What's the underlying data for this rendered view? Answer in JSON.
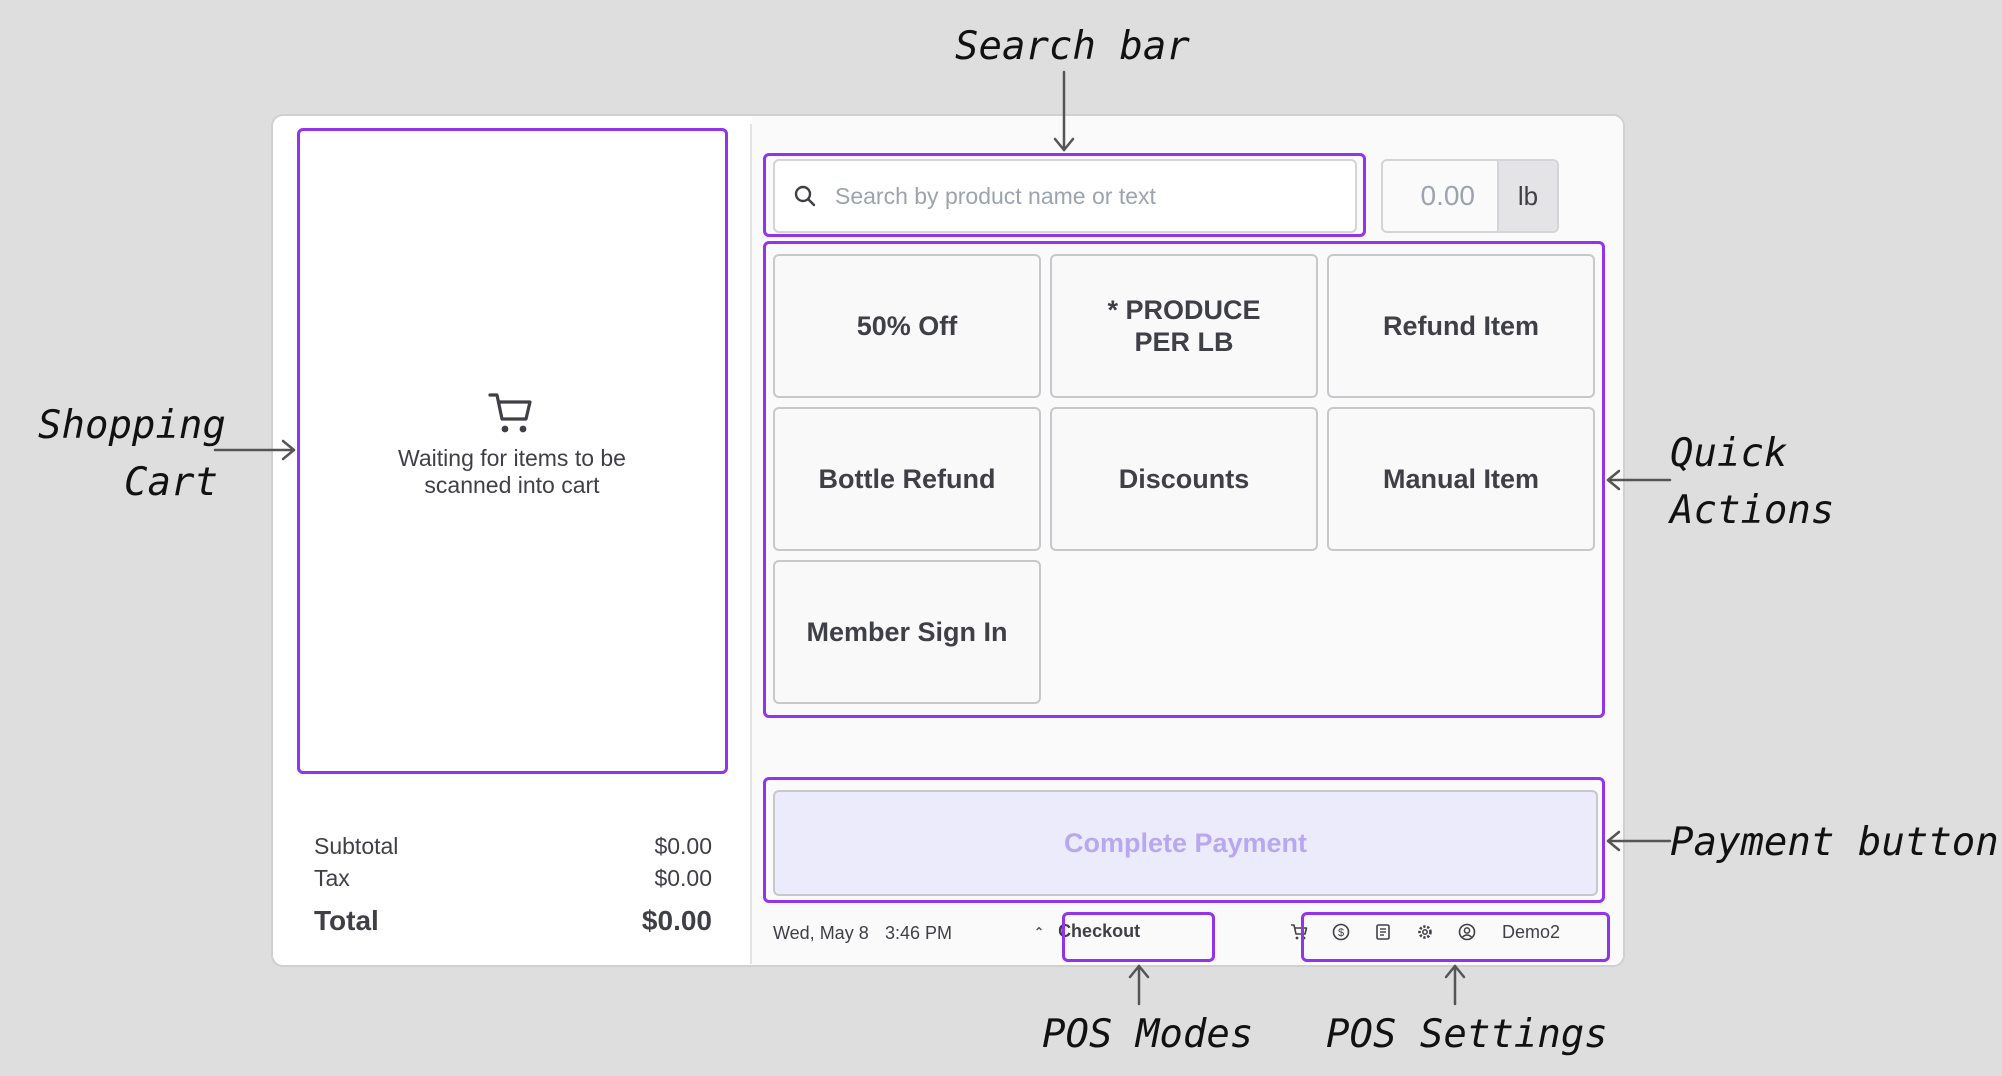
{
  "cart": {
    "icon": "shopping-cart-icon",
    "empty_message": "Waiting for items to be scanned into cart"
  },
  "totals": {
    "subtotal_label": "Subtotal",
    "subtotal_value": "$0.00",
    "tax_label": "Tax",
    "tax_value": "$0.00",
    "total_label": "Total",
    "total_value": "$0.00"
  },
  "search": {
    "placeholder": "Search by product name or text",
    "icon": "search-icon"
  },
  "scale": {
    "value": "0.00",
    "unit": "lb"
  },
  "quick_actions": [
    {
      "label": "50% Off"
    },
    {
      "label": "* PRODUCE\nPER LB"
    },
    {
      "label": "Refund Item"
    },
    {
      "label": "Bottle Refund"
    },
    {
      "label": "Discounts"
    },
    {
      "label": "Manual Item"
    },
    {
      "label": "Member Sign In"
    }
  ],
  "payment": {
    "label": "Complete Payment"
  },
  "status_bar": {
    "date": "Wed, May 8",
    "time": "3:46 PM",
    "mode": "Checkout",
    "icons": [
      "cart-icon",
      "dollar-circle-icon",
      "receipt-icon",
      "gear-icon",
      "user-circle-icon"
    ],
    "user": "Demo2"
  },
  "annotations": {
    "search_bar": "Search bar",
    "shopping_cart_1": "Shopping",
    "shopping_cart_2": "Cart",
    "quick_actions_1": "Quick",
    "quick_actions_2": "Actions",
    "payment_button": "Payment button",
    "pos_modes": "POS Modes",
    "pos_settings": "POS Settings"
  },
  "colors": {
    "highlight": "#9333ea",
    "payment_bg": "#ebebfb",
    "payment_text": "#b9a8f0",
    "background": "#dedede"
  }
}
